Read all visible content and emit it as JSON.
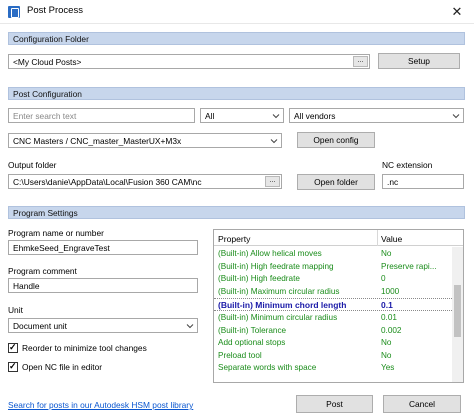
{
  "window": {
    "title": "Post Process",
    "close_glyph": "✕"
  },
  "config_folder": {
    "section_title": "Configuration Folder",
    "path": "<My Cloud Posts>",
    "setup_label": "Setup"
  },
  "post_config": {
    "section_title": "Post Configuration",
    "search_placeholder": "Enter search text",
    "filter_value": "All",
    "vendor_value": "All vendors",
    "post_value": "CNC Masters / CNC_master_MasterUX+M3x",
    "open_config_label": "Open config",
    "output_folder_label": "Output folder",
    "output_folder_path": "C:\\Users\\danie\\AppData\\Local\\Fusion 360 CAM\\nc",
    "open_folder_label": "Open folder",
    "nc_extension_label": "NC extension",
    "nc_extension_value": ".nc"
  },
  "program_settings": {
    "section_title": "Program Settings",
    "program_name_label": "Program name or number",
    "program_name_value": "EhmkeSeed_EngraveTest",
    "program_comment_label": "Program comment",
    "program_comment_value": "Handle",
    "unit_label": "Unit",
    "unit_value": "Document unit",
    "reorder_label": "Reorder to minimize tool changes",
    "reorder_checked": true,
    "open_nc_label": "Open NC file in editor",
    "open_nc_checked": true,
    "property_grid": {
      "header_property": "Property",
      "header_value": "Value",
      "rows": [
        {
          "property": "(Built-in) Allow helical moves",
          "value": "No"
        },
        {
          "property": "(Built-in) High feedrate mapping",
          "value": "Preserve rapi..."
        },
        {
          "property": "(Built-in) High feedrate",
          "value": "0"
        },
        {
          "property": "(Built-in) Maximum circular radius",
          "value": "1000"
        },
        {
          "property": "(Built-in) Minimum chord length",
          "value": "0.1"
        },
        {
          "property": "(Built-in) Minimum circular radius",
          "value": "0.01"
        },
        {
          "property": "(Built-in) Tolerance",
          "value": "0.002"
        },
        {
          "property": "Add optional stops",
          "value": "No"
        },
        {
          "property": "Preload tool",
          "value": "No"
        },
        {
          "property": "Separate words with space",
          "value": "Yes"
        }
      ]
    }
  },
  "footer": {
    "library_link": "Search for posts in our Autodesk HSM post library",
    "post_label": "Post",
    "cancel_label": "Cancel"
  },
  "colors": {
    "section_bg": "#c7d6ec",
    "builtin_green": "#1a8c1a",
    "selected_blue": "#1a1aa8",
    "link_blue": "#0b57d0"
  }
}
